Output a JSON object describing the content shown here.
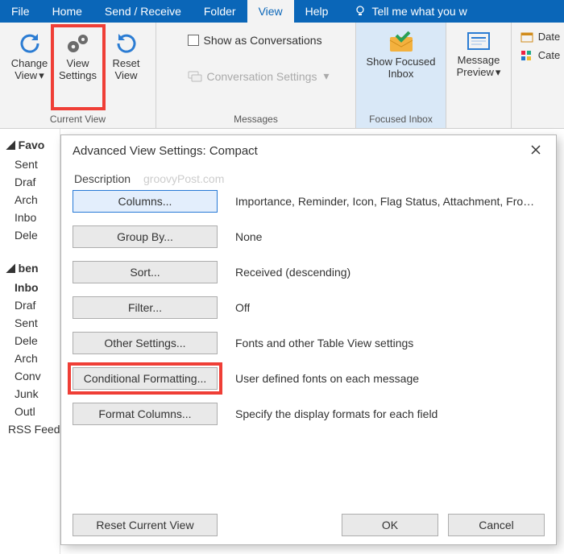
{
  "tabs": [
    "File",
    "Home",
    "Send / Receive",
    "Folder",
    "View",
    "Help",
    "Tell me what you w"
  ],
  "tab_selected_index": 4,
  "ribbon": {
    "current_view": {
      "label": "Current View",
      "change_view": "Change View",
      "view_settings": "View Settings",
      "reset_view": "Reset View"
    },
    "messages": {
      "label": "Messages",
      "show_as_conversations": "Show as Conversations",
      "conversation_settings": "Conversation Settings"
    },
    "focused": {
      "label": "Focused Inbox",
      "show_focused": "Show Focused Inbox"
    },
    "arrangement": {
      "message_preview": "Message Preview"
    },
    "right_cut": {
      "date": "Date",
      "cate": "Cate"
    }
  },
  "nav": {
    "fav_header": "Favo",
    "fav_items": [
      "Sent",
      "Draf",
      "Arch",
      "Inbo",
      "Dele"
    ],
    "acct_header": "ben",
    "acct_items": [
      "Inbo",
      "Draf",
      "Sent",
      "Dele",
      "Arch",
      "Conv",
      "Junk",
      "Outl",
      "RSS Feeds"
    ]
  },
  "dialog": {
    "title": "Advanced View Settings: Compact",
    "section_label": "Description",
    "watermark": "groovyPost.com",
    "rows": [
      {
        "btn": "Columns...",
        "desc": "Importance, Reminder, Icon, Flag Status, Attachment, From, Su...",
        "focus": true
      },
      {
        "btn": "Group By...",
        "desc": "None"
      },
      {
        "btn": "Sort...",
        "desc": "Received (descending)"
      },
      {
        "btn": "Filter...",
        "desc": "Off"
      },
      {
        "btn": "Other Settings...",
        "desc": "Fonts and other Table View settings"
      },
      {
        "btn": "Conditional Formatting...",
        "desc": "User defined fonts on each message",
        "highlight": true
      },
      {
        "btn": "Format Columns...",
        "desc": "Specify the display formats for each field"
      }
    ],
    "reset": "Reset Current View",
    "ok": "OK",
    "cancel": "Cancel"
  }
}
